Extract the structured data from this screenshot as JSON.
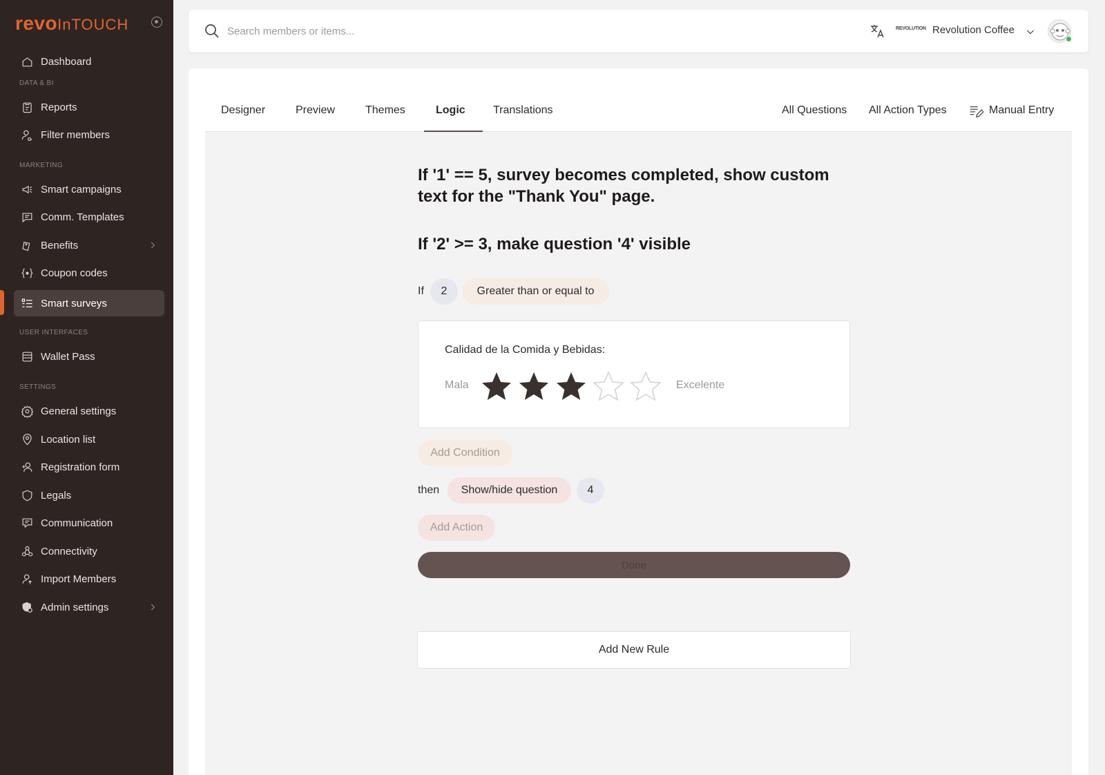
{
  "brand": {
    "part1": "revo",
    "part2": "InTOUCH"
  },
  "sidebar": {
    "items": [
      {
        "label": "Dashboard"
      },
      {
        "label": "Reports"
      },
      {
        "label": "Filter members"
      },
      {
        "label": "Smart campaigns"
      },
      {
        "label": "Comm. Templates"
      },
      {
        "label": "Benefits"
      },
      {
        "label": "Coupon codes"
      },
      {
        "label": "Smart surveys"
      },
      {
        "label": "Wallet Pass"
      },
      {
        "label": "General settings"
      },
      {
        "label": "Location list"
      },
      {
        "label": "Registration form"
      },
      {
        "label": "Legals"
      },
      {
        "label": "Communication"
      },
      {
        "label": "Connectivity"
      },
      {
        "label": "Import Members"
      },
      {
        "label": "Admin settings"
      }
    ],
    "sections": [
      "DATA & BI",
      "MARKETING",
      "USER INTERFACES",
      "SETTINGS"
    ]
  },
  "topbar": {
    "search_placeholder": "Search members or items...",
    "org_logo_text": "REVOLUTION",
    "org_name": "Revolution Coffee"
  },
  "tabs": [
    "Designer",
    "Preview",
    "Themes",
    "Logic",
    "Translations"
  ],
  "right_links": {
    "all_questions": "All Questions",
    "all_action_types": "All Action Types",
    "manual_entry": "Manual Entry"
  },
  "rules": {
    "rule1": "If '1' == 5, survey becomes completed, show custom text for the \"Thank You\" page.",
    "rule2": "If '2' >= 3, make question '4' visible"
  },
  "editor": {
    "if_label": "If",
    "question_num": "2",
    "condition": "Greater than or equal to",
    "question_title": "Calidad de la Comida y Bebidas:",
    "low_label": "Mala",
    "high_label": "Excelente",
    "rating": {
      "value": 3,
      "max": 5
    },
    "add_condition": "Add Condition",
    "then_label": "then",
    "action": "Show/hide question",
    "action_target": "4",
    "add_action": "Add Action",
    "done": "Done"
  },
  "add_new_rule": "Add New Rule"
}
